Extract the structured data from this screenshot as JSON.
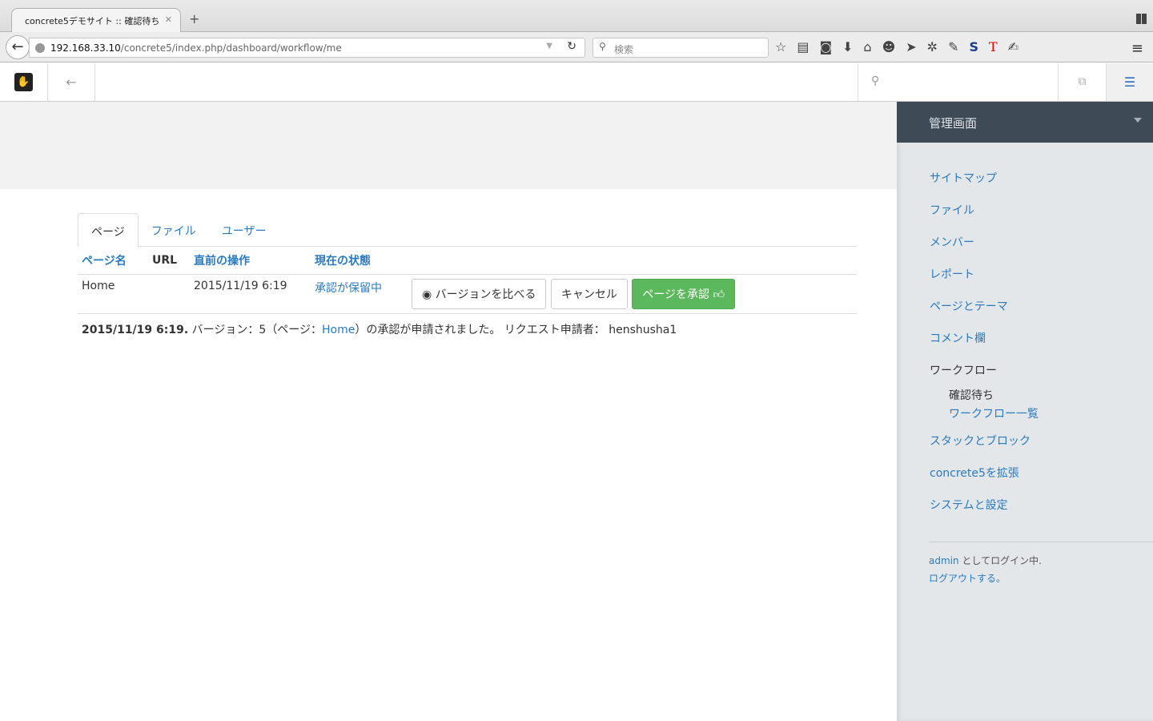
{
  "browser": {
    "tab_title": "concrete5デモサイト :: 確認待ち",
    "url_host": "192.168.33.10",
    "url_path": "/concrete5/index.php/dashboard/workflow/me",
    "search_placeholder": "検索"
  },
  "tabs": [
    {
      "label": "ページ"
    },
    {
      "label": "ファイル"
    },
    {
      "label": "ユーザー"
    }
  ],
  "table": {
    "headers": [
      "ページ名",
      "URL",
      "直前の操作",
      "現在の状態"
    ],
    "rows": [
      {
        "name": "Home",
        "url": "",
        "last_action": "2015/11/19 6:19",
        "status": "承認が保留中"
      }
    ],
    "buttons": {
      "compare": "バージョンを比べる",
      "cancel": "キャンセル",
      "approve": "ページを承認"
    }
  },
  "note": {
    "date": "2015/11/19 6:19.",
    "text1": "バージョン：5（ページ：",
    "link": "Home",
    "text2": "）の承認が申請されました。 リクエスト申請者： henshusha1"
  },
  "sidebar": {
    "title": "管理画面",
    "items": [
      {
        "label": "サイトマップ"
      },
      {
        "label": "ファイル"
      },
      {
        "label": "メンバー"
      },
      {
        "label": "レポート"
      },
      {
        "label": "ページとテーマ"
      },
      {
        "label": "コメント欄"
      },
      {
        "label": "ワークフロー"
      },
      {
        "label": "スタックとブロック"
      },
      {
        "label": "concrete5を拡張"
      },
      {
        "label": "システムと設定"
      }
    ],
    "sub": [
      {
        "label": "確認待ち"
      },
      {
        "label": "ワークフロー一覧"
      }
    ],
    "user": "admin",
    "logged_in": " としてログイン中.",
    "logout": "ログアウトする。"
  }
}
